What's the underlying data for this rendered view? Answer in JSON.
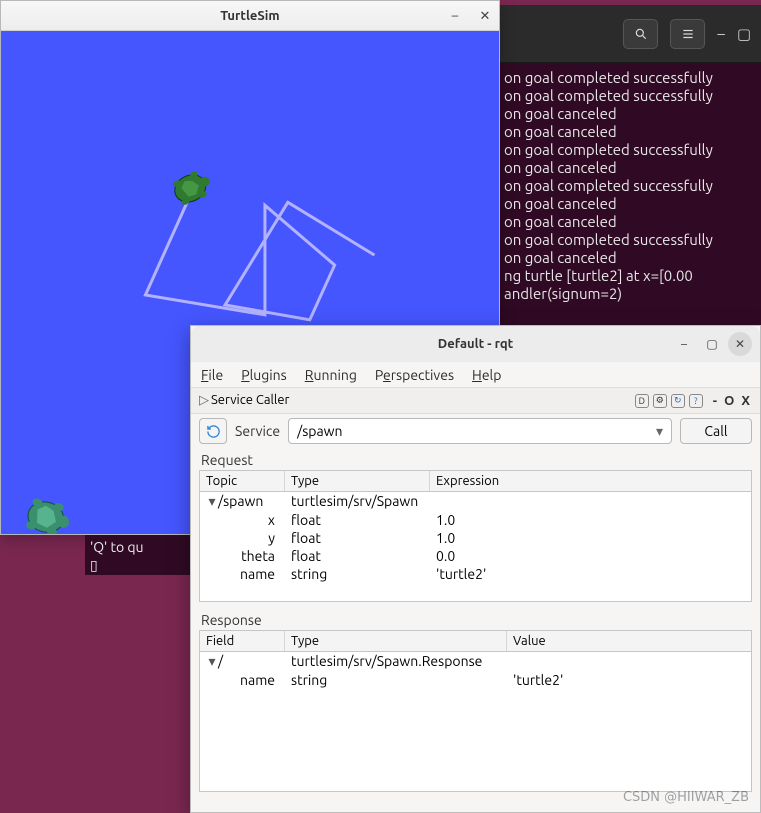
{
  "turtlesim": {
    "title": "TurtleSim"
  },
  "terminal_lines": [
    "on goal completed successfully",
    "on goal completed successfully",
    "on goal canceled",
    "on goal canceled",
    "on goal completed successfully",
    "on goal canceled",
    "on goal completed successfully",
    "on goal canceled",
    "on goal canceled",
    "on goal completed successfully",
    "on goal canceled",
    "ng turtle [turtle2] at x=[0.00",
    "",
    "andler(signum=2)"
  ],
  "terminal2": {
    "line1": "'Q' to qu",
    "line2_cursor": "▯"
  },
  "rqt": {
    "title": "Default - rqt",
    "menu": {
      "file": "File",
      "plugins": "Plugins",
      "running": "Running",
      "perspectives": "Perspectives",
      "help": "Help"
    },
    "service_caller_label": "Service Caller",
    "toolbar_right": [
      "D",
      "⚙",
      "↻",
      "?"
    ],
    "toolbar_suffix": "- O X",
    "service_label": "Service",
    "service_value": "/spawn",
    "call_label": "Call",
    "request_label": "Request",
    "request_headers": {
      "topic": "Topic",
      "type": "Type",
      "expression": "Expression"
    },
    "request_root": {
      "topic": "/spawn",
      "type": "turtlesim/srv/Spawn",
      "expression": ""
    },
    "request_children": [
      {
        "topic": "x",
        "type": "float",
        "expression": "1.0"
      },
      {
        "topic": "y",
        "type": "float",
        "expression": "1.0"
      },
      {
        "topic": "theta",
        "type": "float",
        "expression": "0.0"
      },
      {
        "topic": "name",
        "type": "string",
        "expression": "'turtle2'"
      }
    ],
    "response_label": "Response",
    "response_headers": {
      "field": "Field",
      "type": "Type",
      "value": "Value"
    },
    "response_root": {
      "field": "/",
      "type": "turtlesim/srv/Spawn.Response",
      "value": ""
    },
    "response_children": [
      {
        "field": "name",
        "type": "string",
        "value": "'turtle2'"
      }
    ]
  },
  "watermark": "CSDN @HIIWAR_ZB"
}
